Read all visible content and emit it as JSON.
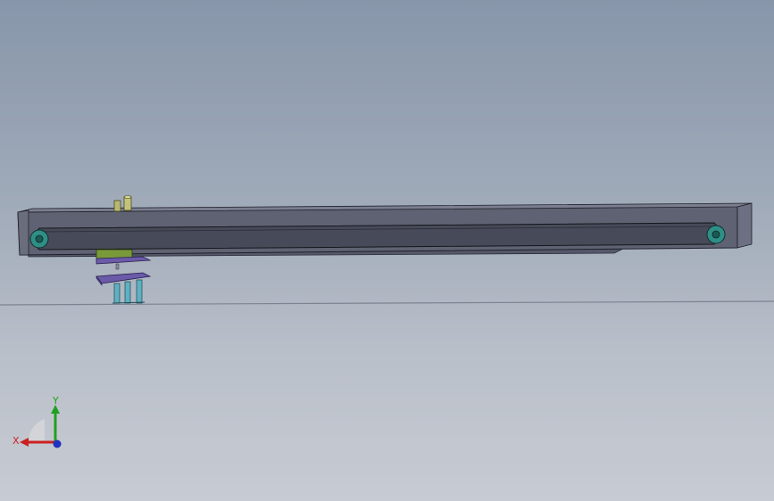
{
  "viewport": {
    "background_top": "#8796aa",
    "background_bottom": "#c7cbd3"
  },
  "model": {
    "beam_color": "#5f6272",
    "belt_color": "#474a58",
    "pulley_color": "#2f8f86",
    "carriage_top_color": "#7a9a3a",
    "plate_color": "#6a5aa8",
    "column_color": "#5fb0c0",
    "post_color": "#b8b870"
  },
  "triad": {
    "x_label": "X",
    "y_label": "Y",
    "x_color": "#cc2020",
    "y_color": "#20a020",
    "z_color": "#2030c0"
  }
}
